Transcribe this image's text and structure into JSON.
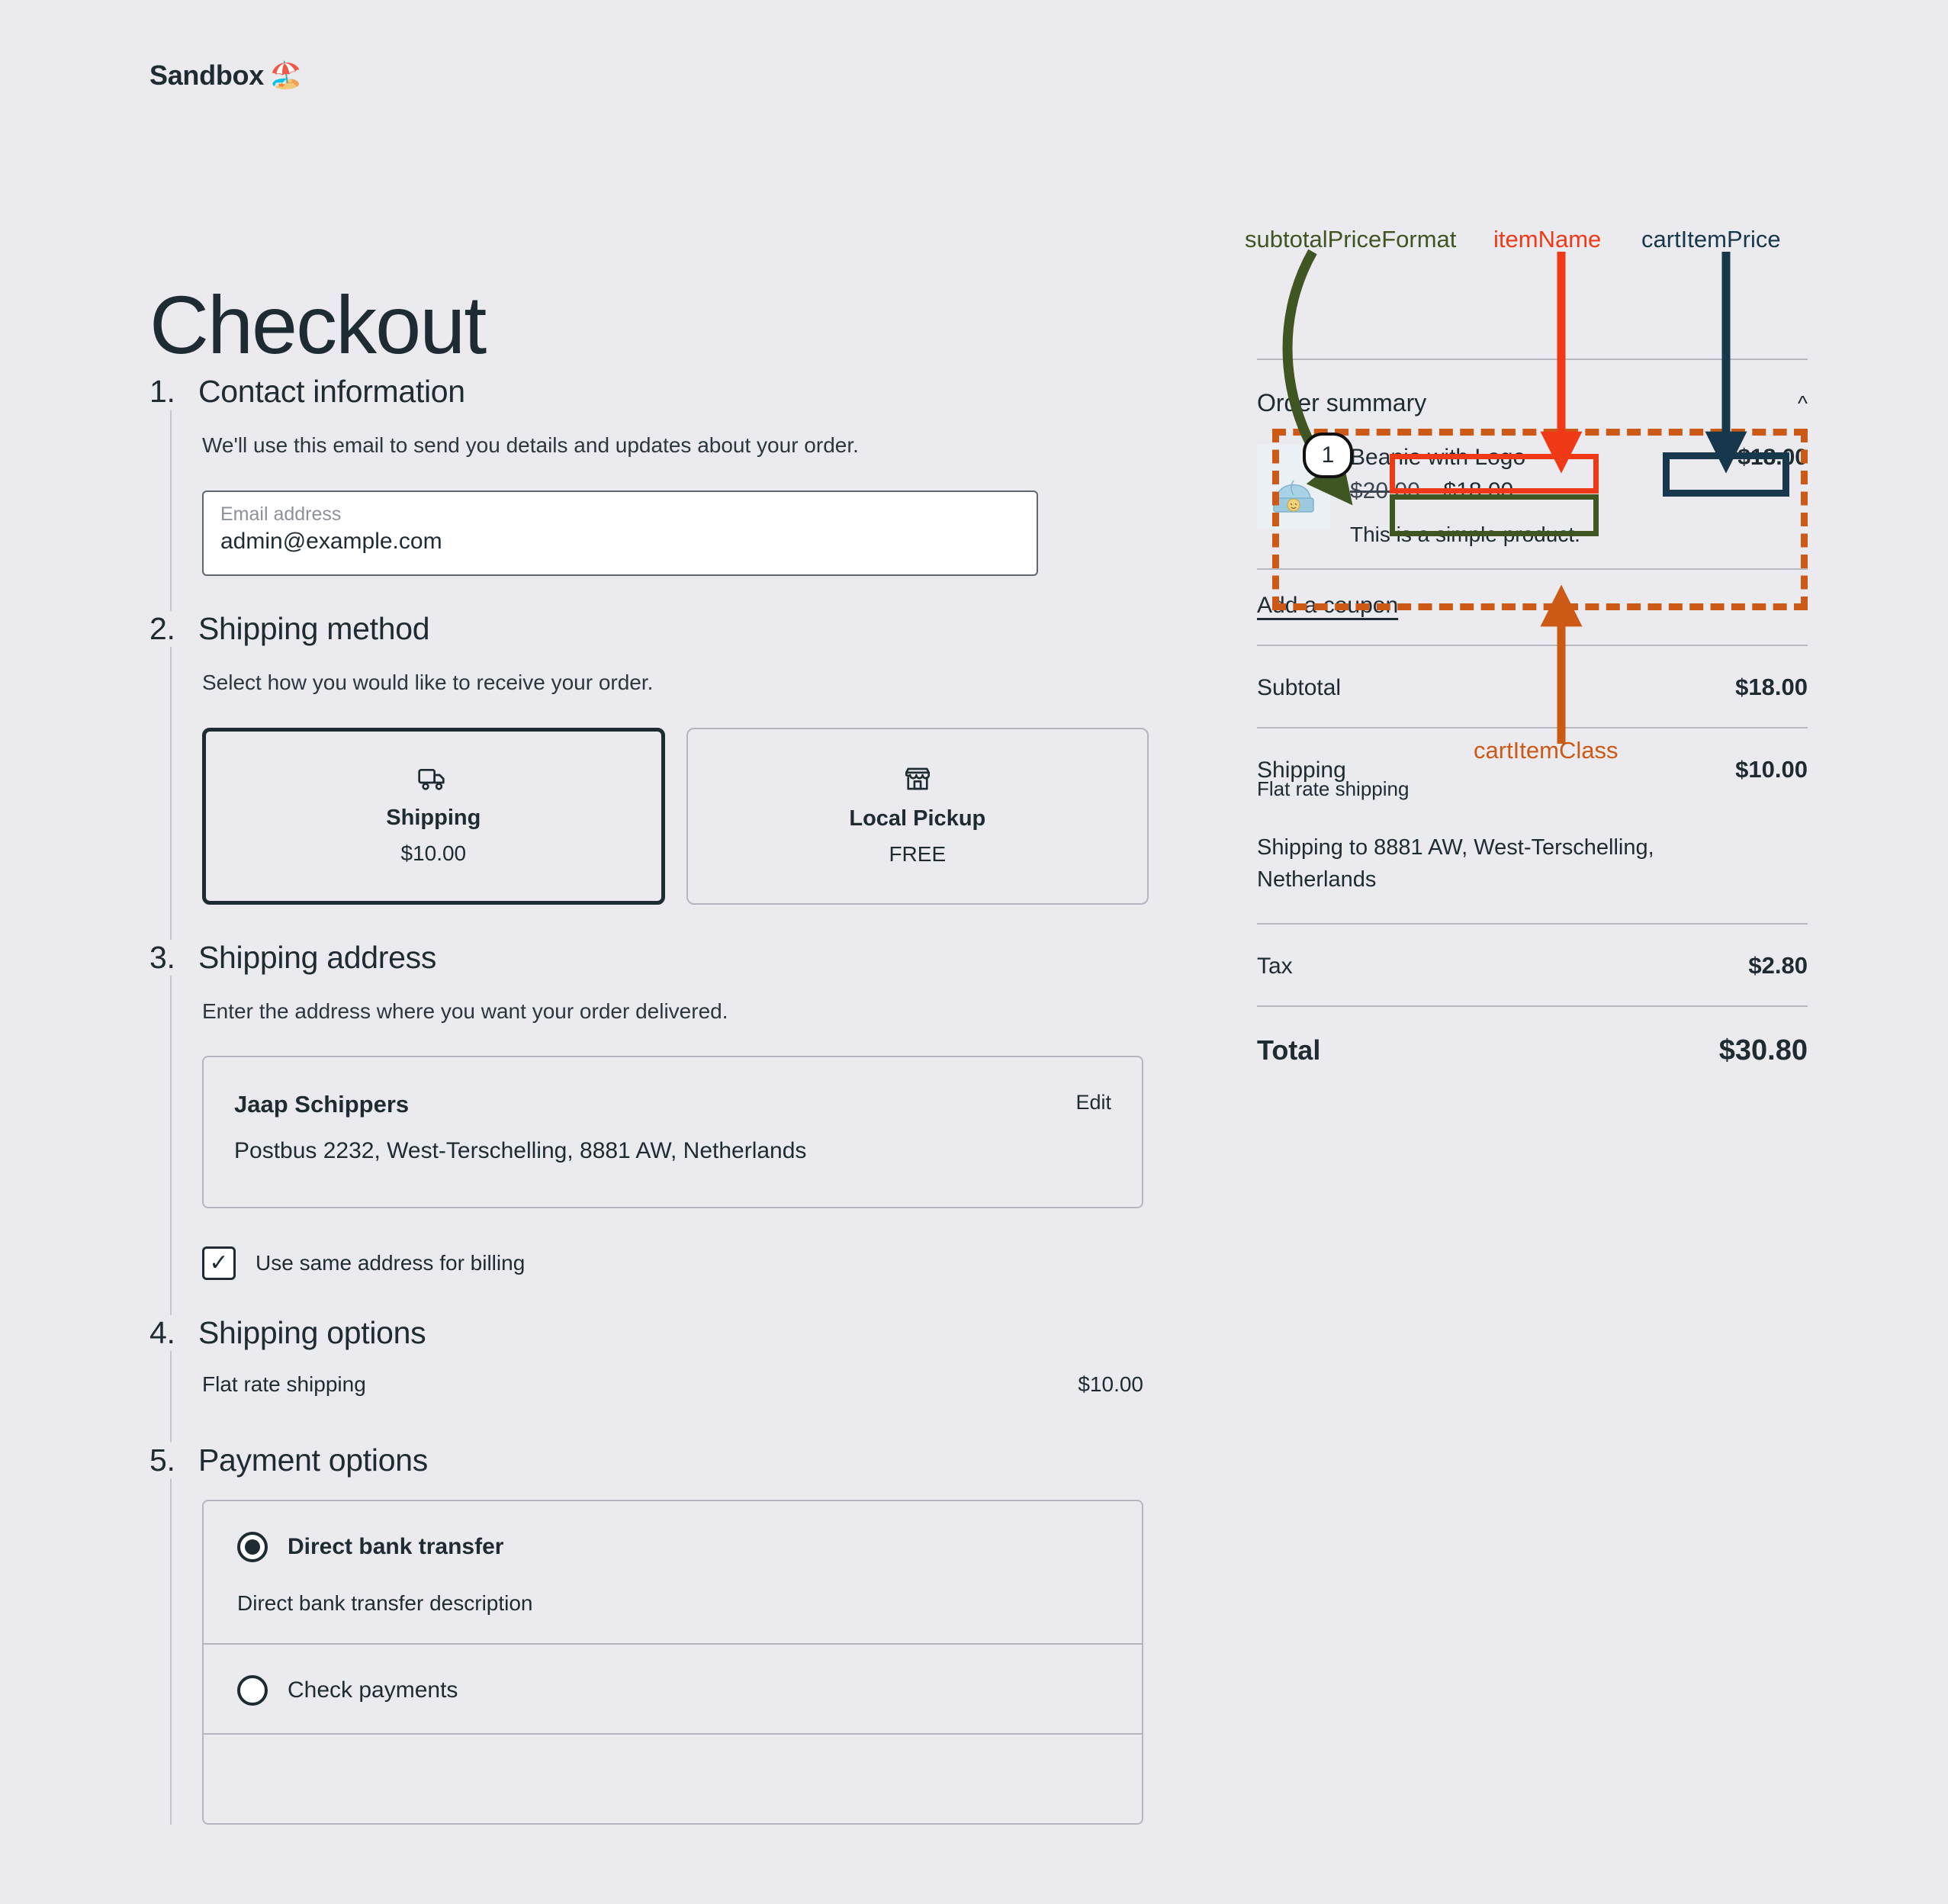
{
  "header": {
    "brand": "Sandbox",
    "brand_emoji": "🏖️"
  },
  "page": {
    "title": "Checkout"
  },
  "steps": [
    {
      "num": "1.",
      "title": "Contact information",
      "desc": "We'll use this email to send you details and updates about your order.",
      "email_label": "Email address",
      "email_value": "admin@example.com",
      "email_placeholder": "Email address"
    },
    {
      "num": "2.",
      "title": "Shipping method",
      "desc": "Select how you would like to receive your order.",
      "methods": [
        {
          "name": "Shipping",
          "price": "$10.00",
          "icon": "truck-icon",
          "selected": true
        },
        {
          "name": "Local Pickup",
          "price": "FREE",
          "icon": "storefront-icon",
          "selected": false
        }
      ]
    },
    {
      "num": "3.",
      "title": "Shipping address",
      "desc": "Enter the address where you want your order delivered.",
      "recipient": "Jaap Schippers",
      "address": "Postbus 2232, West-Terschelling, 8881 AW, Netherlands",
      "edit_label": "Edit",
      "billing_checkbox_label": "Use same address for billing",
      "billing_checked": true
    },
    {
      "num": "4.",
      "title": "Shipping options",
      "option_label": "Flat rate shipping",
      "option_price": "$10.00"
    },
    {
      "num": "5.",
      "title": "Payment options",
      "payments": [
        {
          "name": "Direct bank transfer",
          "desc": "Direct bank transfer description",
          "selected": true
        },
        {
          "name": "Check payments",
          "desc": "",
          "selected": false
        }
      ]
    }
  ],
  "summary": {
    "heading": "Order summary",
    "collapse_icon": "chevron-up-icon",
    "item": {
      "qty": "1",
      "name": "Beanie with Logo",
      "price_old": "$20.00",
      "price_new": "$18.00",
      "description": "This is a simple product.",
      "line_total": "$18.00",
      "thumb_alt": "beanie-thumbnail"
    },
    "coupon_label": "Add a coupon",
    "rows": [
      {
        "label": "Subtotal",
        "value": "$18.00"
      },
      {
        "label": "Shipping",
        "value": "$10.00",
        "sub": "Flat rate shipping"
      },
      {
        "label": "Tax",
        "value": "$2.80"
      }
    ],
    "ship_to": "Shipping to 8881 AW, West-Terschelling, Netherlands",
    "total_label": "Total",
    "total_value": "$30.80"
  },
  "annotations": {
    "labels": [
      {
        "text": "subtotalPriceFormat",
        "color": "#3f5522"
      },
      {
        "text": "itemName",
        "color": "#f03a17"
      },
      {
        "text": "cartItemPrice",
        "color": "#17384c"
      },
      {
        "text": "cartItemClass",
        "color": "#cc5a16"
      }
    ],
    "colors": {
      "green": "#3f5522",
      "red": "#f03a17",
      "navy": "#17384c",
      "orange": "#cc5a16"
    }
  }
}
